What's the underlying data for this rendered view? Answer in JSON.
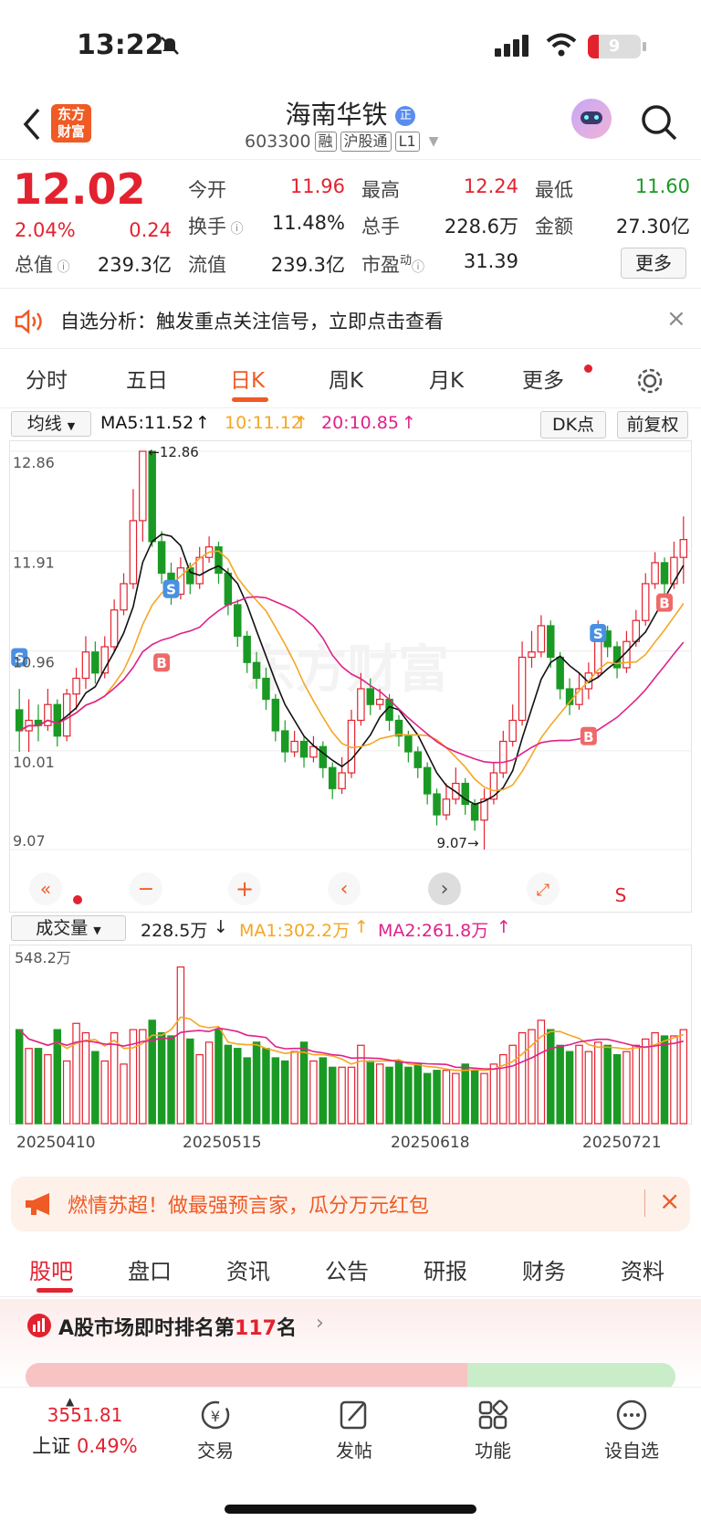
{
  "status": {
    "time": "13:22",
    "battery": "9"
  },
  "header": {
    "brand_logo": "东方财富",
    "name": "海南华铁",
    "name_badge": "正",
    "code": "603300",
    "tags": [
      "融",
      "沪股通",
      "L1"
    ]
  },
  "quote": {
    "price": "12.02",
    "pct": "2.04%",
    "change": "0.24",
    "open_label": "今开",
    "open": "11.96",
    "high_label": "最高",
    "high": "12.24",
    "low_label": "最低",
    "low": "11.60",
    "turnover_label": "换手",
    "turnover": "11.48%",
    "volume_label": "总手",
    "volume": "228.6万",
    "amount_label": "金额",
    "amount": "27.30亿",
    "mktcap_label": "总值",
    "mktcap": "239.3亿",
    "float_label": "流值",
    "float": "239.3亿",
    "pe_label": "市盈",
    "pe_sup": "动",
    "pe": "31.39",
    "more": "更多"
  },
  "notice": {
    "text": "自选分析：触发重点关注信号，立即点击查看"
  },
  "chart_tabs": {
    "items": [
      "分时",
      "五日",
      "日K",
      "周K",
      "月K",
      "更多"
    ],
    "active": "日K"
  },
  "indicator": {
    "ma_select": "均线",
    "ma5": "MA5:11.52",
    "ma10": "10:11.12",
    "ma20": "20:10.85",
    "dk": "DK点",
    "adjust": "前复权"
  },
  "colors": {
    "up": "#e3222f",
    "down": "#1a9a24",
    "ma5": "#111111",
    "ma10": "#f5a623",
    "ma20": "#e0218a",
    "brand": "#f05a24"
  },
  "chart_data": [
    {
      "type": "candlestick",
      "y_ticks": [
        "12.86",
        "11.91",
        "10.96",
        "10.01",
        "9.07"
      ],
      "ylim": [
        9.07,
        12.86
      ],
      "max_label": "←12.86",
      "min_label": "9.07→",
      "x_labels": [
        "20250410",
        "20250515",
        "20250618",
        "20250721"
      ],
      "markers": [
        {
          "label": "S",
          "index": 0,
          "price": 10.9
        },
        {
          "label": "S",
          "index": 16,
          "price": 11.55
        },
        {
          "label": "B",
          "index": 15,
          "price": 10.85
        },
        {
          "label": "S",
          "index": 61,
          "price": 11.13
        },
        {
          "label": "B",
          "index": 60,
          "price": 10.15
        },
        {
          "label": "B",
          "index": 68,
          "price": 11.42
        }
      ],
      "candles": [
        [
          10.4,
          10.2,
          10.6,
          10.0
        ],
        [
          10.2,
          10.3,
          10.5,
          10.0
        ],
        [
          10.3,
          10.25,
          10.45,
          10.1
        ],
        [
          10.25,
          10.45,
          10.6,
          10.2
        ],
        [
          10.45,
          10.15,
          10.5,
          10.05
        ],
        [
          10.15,
          10.55,
          10.6,
          10.1
        ],
        [
          10.55,
          10.7,
          10.8,
          10.4
        ],
        [
          10.7,
          10.95,
          11.1,
          10.6
        ],
        [
          10.95,
          10.75,
          11.05,
          10.65
        ],
        [
          10.75,
          11.0,
          11.1,
          10.7
        ],
        [
          11.0,
          11.35,
          11.45,
          10.95
        ],
        [
          11.35,
          11.6,
          11.7,
          11.3
        ],
        [
          11.6,
          12.2,
          12.5,
          11.55
        ],
        [
          12.2,
          12.86,
          12.86,
          12.0
        ],
        [
          12.86,
          12.0,
          12.86,
          11.95
        ],
        [
          12.0,
          11.7,
          12.1,
          11.6
        ],
        [
          11.7,
          11.5,
          11.8,
          11.4
        ],
        [
          11.5,
          11.75,
          11.85,
          11.45
        ],
        [
          11.75,
          11.6,
          11.8,
          11.5
        ],
        [
          11.6,
          11.85,
          11.95,
          11.55
        ],
        [
          11.85,
          11.95,
          12.05,
          11.8
        ],
        [
          11.95,
          11.7,
          12.0,
          11.6
        ],
        [
          11.7,
          11.4,
          11.75,
          11.3
        ],
        [
          11.4,
          11.1,
          11.45,
          11.0
        ],
        [
          11.1,
          10.85,
          11.15,
          10.75
        ],
        [
          10.85,
          10.7,
          10.95,
          10.6
        ],
        [
          10.7,
          10.5,
          10.8,
          10.4
        ],
        [
          10.5,
          10.2,
          10.55,
          10.1
        ],
        [
          10.2,
          10.0,
          10.3,
          9.9
        ],
        [
          10.0,
          10.1,
          10.2,
          9.95
        ],
        [
          10.1,
          9.95,
          10.15,
          9.85
        ],
        [
          9.95,
          10.05,
          10.15,
          9.9
        ],
        [
          10.05,
          9.85,
          10.1,
          9.75
        ],
        [
          9.85,
          9.65,
          9.9,
          9.55
        ],
        [
          9.65,
          9.8,
          9.95,
          9.6
        ],
        [
          9.8,
          10.3,
          10.4,
          9.75
        ],
        [
          10.3,
          10.6,
          10.75,
          10.25
        ],
        [
          10.6,
          10.45,
          10.7,
          10.35
        ],
        [
          10.45,
          10.5,
          10.6,
          10.4
        ],
        [
          10.5,
          10.3,
          10.55,
          10.2
        ],
        [
          10.3,
          10.15,
          10.35,
          10.05
        ],
        [
          10.15,
          10.0,
          10.2,
          9.9
        ],
        [
          10.0,
          9.85,
          10.05,
          9.75
        ],
        [
          9.85,
          9.6,
          9.9,
          9.5
        ],
        [
          9.6,
          9.4,
          9.65,
          9.3
        ],
        [
          9.4,
          9.55,
          9.7,
          9.35
        ],
        [
          9.55,
          9.7,
          9.85,
          9.5
        ],
        [
          9.7,
          9.5,
          9.75,
          9.4
        ],
        [
          9.5,
          9.35,
          9.55,
          9.25
        ],
        [
          9.35,
          9.55,
          9.65,
          9.07
        ],
        [
          9.55,
          9.8,
          9.9,
          9.5
        ],
        [
          9.8,
          10.1,
          10.2,
          9.75
        ],
        [
          10.1,
          10.3,
          10.45,
          10.05
        ],
        [
          10.3,
          10.9,
          11.05,
          10.25
        ],
        [
          10.9,
          10.95,
          11.15,
          10.8
        ],
        [
          10.95,
          11.2,
          11.3,
          10.9
        ],
        [
          11.2,
          10.9,
          11.25,
          10.8
        ],
        [
          10.9,
          10.6,
          10.95,
          10.5
        ],
        [
          10.6,
          10.45,
          10.7,
          10.35
        ],
        [
          10.45,
          10.6,
          10.75,
          10.4
        ],
        [
          10.6,
          10.75,
          10.85,
          10.5
        ],
        [
          10.75,
          11.15,
          11.25,
          10.7
        ],
        [
          11.15,
          11.0,
          11.2,
          10.9
        ],
        [
          11.0,
          10.8,
          11.05,
          10.7
        ],
        [
          10.8,
          11.05,
          11.15,
          10.75
        ],
        [
          11.05,
          11.25,
          11.35,
          11.0
        ],
        [
          11.25,
          11.6,
          11.7,
          11.2
        ],
        [
          11.6,
          11.8,
          11.9,
          11.55
        ],
        [
          11.8,
          11.6,
          11.85,
          11.5
        ],
        [
          11.6,
          11.85,
          12.0,
          11.55
        ],
        [
          11.85,
          12.02,
          12.24,
          11.6
        ]
      ]
    },
    {
      "type": "bar",
      "title": "成交量",
      "value_label": "228.5万",
      "ma1": "MA1:302.2万",
      "ma2": "MA2:261.8万",
      "y_max_label": "548.2万",
      "ylim": [
        0,
        548.2
      ],
      "values": [
        300,
        240,
        240,
        220,
        300,
        200,
        320,
        290,
        230,
        200,
        290,
        190,
        300,
        300,
        330,
        290,
        280,
        500,
        270,
        220,
        260,
        300,
        250,
        240,
        210,
        260,
        240,
        210,
        200,
        230,
        260,
        200,
        210,
        180,
        180,
        180,
        250,
        200,
        190,
        180,
        200,
        180,
        190,
        160,
        170,
        170,
        160,
        190,
        170,
        160,
        190,
        220,
        250,
        290,
        300,
        330,
        300,
        250,
        230,
        250,
        230,
        260,
        250,
        220,
        230,
        250,
        270,
        290,
        280,
        280,
        300
      ]
    }
  ],
  "bottom_banner": {
    "text": "燃情苏超！做最强预言家，瓜分万元红包"
  },
  "bottom_tabs": {
    "items": [
      "股吧",
      "盘口",
      "资讯",
      "公告",
      "研报",
      "财务",
      "资料"
    ],
    "active": "股吧"
  },
  "ranking": {
    "prefix": "A股市场即时排名第",
    "rank": "117",
    "suffix": "名"
  },
  "bottom_nav": {
    "index_value": "3551.81",
    "index_name": "上证",
    "index_pct": "0.49%",
    "trade": "交易",
    "post": "发帖",
    "function": "功能",
    "add": "设自选"
  }
}
